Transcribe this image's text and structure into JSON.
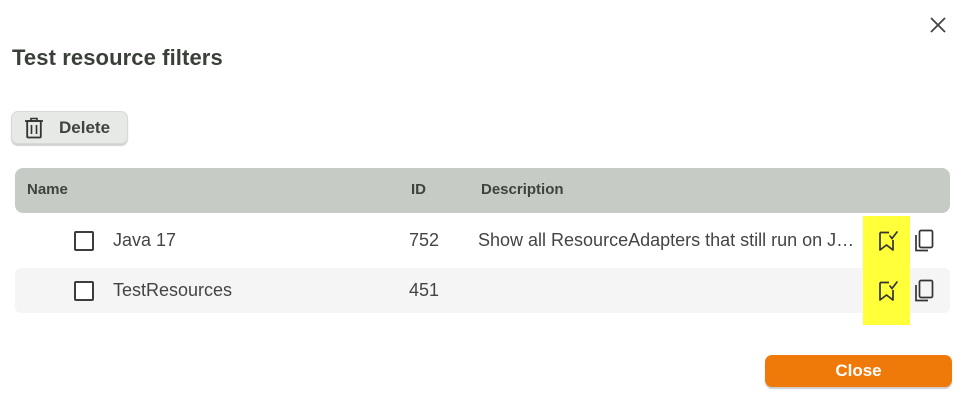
{
  "dialog": {
    "title": "Test resource filters",
    "close_icon": "close-icon"
  },
  "toolbar": {
    "delete_label": "Delete",
    "delete_icon": "trash-icon"
  },
  "table": {
    "columns": {
      "name": "Name",
      "id": "ID",
      "description": "Description"
    },
    "rows": [
      {
        "name": "Java 17",
        "id": "752",
        "description": "Show all ResourceAdapters that still run on J…",
        "checked": false
      },
      {
        "name": "TestResources",
        "id": "451",
        "description": "",
        "checked": false
      }
    ],
    "row_actions": {
      "apply_icon": "bookmark-check-icon",
      "copy_icon": "copy-icon",
      "highlight_color": "#ffff3a"
    }
  },
  "footer": {
    "close_label": "Close",
    "close_color": "#ef7a0a"
  }
}
